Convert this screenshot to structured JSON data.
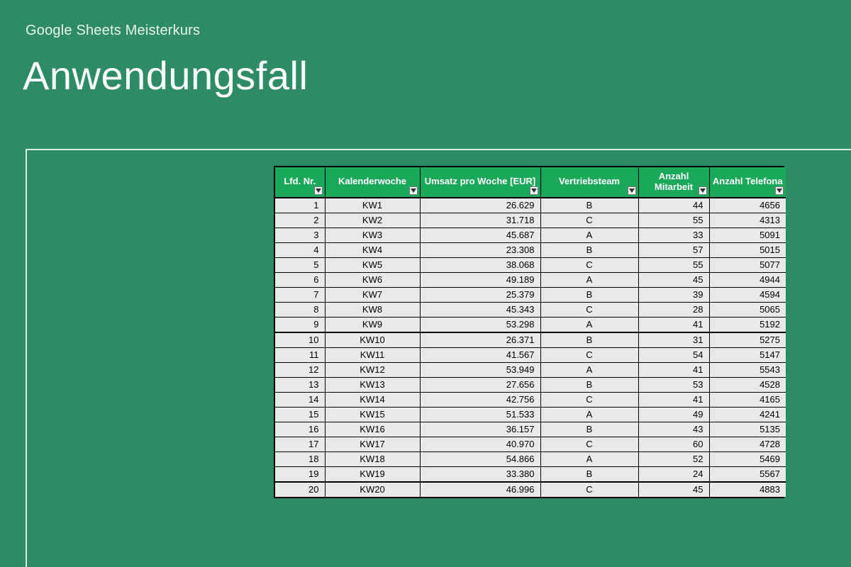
{
  "header": {
    "subtitle": "Google Sheets Meisterkurs",
    "title": "Anwendungsfall"
  },
  "table": {
    "columns": [
      "Lfd. Nr.",
      "Kalenderwoche",
      "Umsatz pro Woche [EUR]",
      "Vertriebsteam",
      "Anzahl Mitarbeit",
      "Anzahl Telefona"
    ],
    "rows": [
      {
        "lfd": "1",
        "kw": "KW1",
        "umsatz": "26.629",
        "team": "B",
        "mit": "44",
        "tel": "4656"
      },
      {
        "lfd": "2",
        "kw": "KW2",
        "umsatz": "31.718",
        "team": "C",
        "mit": "55",
        "tel": "4313"
      },
      {
        "lfd": "3",
        "kw": "KW3",
        "umsatz": "45.687",
        "team": "A",
        "mit": "33",
        "tel": "5091"
      },
      {
        "lfd": "4",
        "kw": "KW4",
        "umsatz": "23.308",
        "team": "B",
        "mit": "57",
        "tel": "5015"
      },
      {
        "lfd": "5",
        "kw": "KW5",
        "umsatz": "38.068",
        "team": "C",
        "mit": "55",
        "tel": "5077"
      },
      {
        "lfd": "6",
        "kw": "KW6",
        "umsatz": "49.189",
        "team": "A",
        "mit": "45",
        "tel": "4944"
      },
      {
        "lfd": "7",
        "kw": "KW7",
        "umsatz": "25.379",
        "team": "B",
        "mit": "39",
        "tel": "4594"
      },
      {
        "lfd": "8",
        "kw": "KW8",
        "umsatz": "45.343",
        "team": "C",
        "mit": "28",
        "tel": "5065"
      },
      {
        "lfd": "9",
        "kw": "KW9",
        "umsatz": "53.298",
        "team": "A",
        "mit": "41",
        "tel": "5192"
      },
      {
        "lfd": "10",
        "kw": "KW10",
        "umsatz": "26.371",
        "team": "B",
        "mit": "31",
        "tel": "5275"
      },
      {
        "lfd": "11",
        "kw": "KW11",
        "umsatz": "41.567",
        "team": "C",
        "mit": "54",
        "tel": "5147"
      },
      {
        "lfd": "12",
        "kw": "KW12",
        "umsatz": "53.949",
        "team": "A",
        "mit": "41",
        "tel": "5543"
      },
      {
        "lfd": "13",
        "kw": "KW13",
        "umsatz": "27.656",
        "team": "B",
        "mit": "53",
        "tel": "4528"
      },
      {
        "lfd": "14",
        "kw": "KW14",
        "umsatz": "42.756",
        "team": "C",
        "mit": "41",
        "tel": "4165"
      },
      {
        "lfd": "15",
        "kw": "KW15",
        "umsatz": "51.533",
        "team": "A",
        "mit": "49",
        "tel": "4241"
      },
      {
        "lfd": "16",
        "kw": "KW16",
        "umsatz": "36.157",
        "team": "B",
        "mit": "43",
        "tel": "5135"
      },
      {
        "lfd": "17",
        "kw": "KW17",
        "umsatz": "40.970",
        "team": "C",
        "mit": "60",
        "tel": "4728"
      },
      {
        "lfd": "18",
        "kw": "KW18",
        "umsatz": "54.866",
        "team": "A",
        "mit": "52",
        "tel": "5469"
      },
      {
        "lfd": "19",
        "kw": "KW19",
        "umsatz": "33.380",
        "team": "B",
        "mit": "24",
        "tel": "5567"
      },
      {
        "lfd": "20",
        "kw": "KW20",
        "umsatz": "46.996",
        "team": "C",
        "mit": "45",
        "tel": "4883"
      }
    ]
  }
}
